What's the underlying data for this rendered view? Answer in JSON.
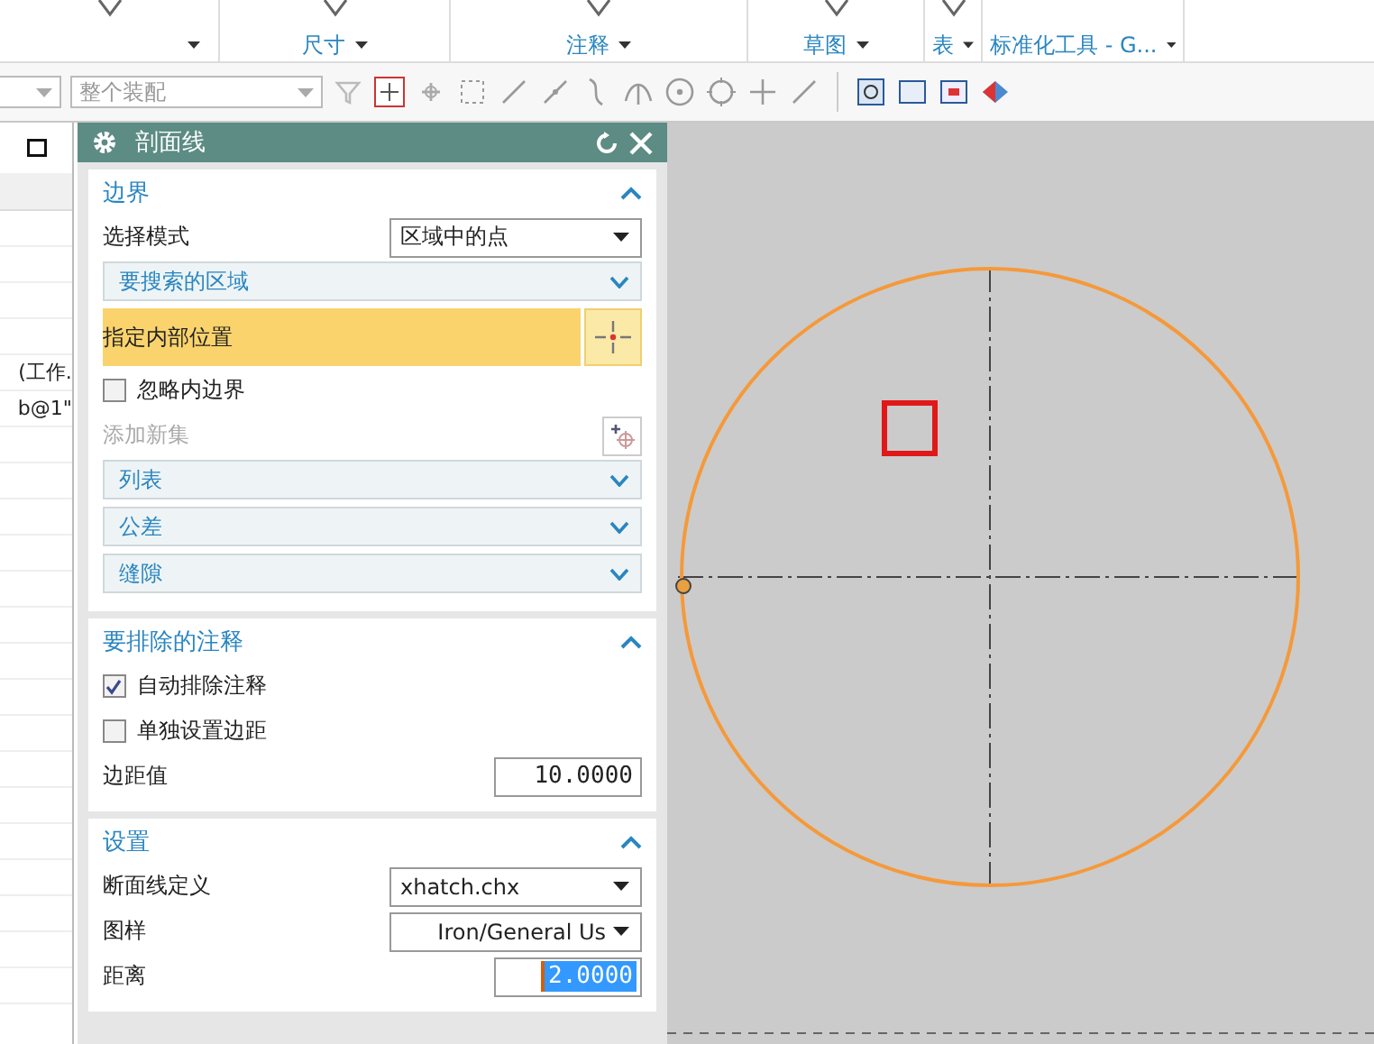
{
  "ribbon": {
    "groups": [
      {
        "label": "尺寸"
      },
      {
        "label": "注释"
      },
      {
        "label": "草图"
      },
      {
        "label": "表"
      },
      {
        "label": "标准化工具 - G..."
      }
    ]
  },
  "toolbar": {
    "assembly_dropdown": {
      "placeholder": "整个装配"
    }
  },
  "left_panel": {
    "rows": [
      "",
      "",
      "",
      "",
      "(工作.",
      "b@1\"",
      "",
      "",
      "",
      "",
      "",
      "",
      "",
      "",
      "",
      "",
      "",
      "",
      "",
      "",
      "",
      ""
    ]
  },
  "dialog": {
    "title": "剖面线",
    "sections": [
      {
        "title": "边界",
        "expanded": true,
        "items": [
          {
            "kind": "select",
            "label": "选择模式",
            "value": "区域中的点"
          },
          {
            "kind": "subgroup",
            "label": "要搜索的区域",
            "expanded": false
          },
          {
            "kind": "pick",
            "label": "指定内部位置",
            "selected": true
          },
          {
            "kind": "checkbox",
            "label": "忽略内边界",
            "checked": false
          },
          {
            "kind": "action",
            "label": "添加新集",
            "disabled": true
          },
          {
            "kind": "subgroup",
            "label": "列表",
            "expanded": false
          },
          {
            "kind": "subgroup",
            "label": "公差",
            "expanded": false
          },
          {
            "kind": "subgroup",
            "label": "缝隙",
            "expanded": false
          }
        ]
      },
      {
        "title": "要排除的注释",
        "expanded": true,
        "items": [
          {
            "kind": "checkbox",
            "label": "自动排除注释",
            "checked": true
          },
          {
            "kind": "checkbox",
            "label": "单独设置边距",
            "checked": false
          },
          {
            "kind": "number",
            "label": "边距值",
            "value": "10.0000",
            "selected": false
          }
        ]
      },
      {
        "title": "设置",
        "expanded": true,
        "items": [
          {
            "kind": "select",
            "label": "断面线定义",
            "value": "xhatch.chx"
          },
          {
            "kind": "select",
            "label": "图样",
            "value": "Iron/General Us"
          },
          {
            "kind": "number",
            "label": "距离",
            "value": "2.0000",
            "selected": true
          }
        ]
      }
    ]
  }
}
